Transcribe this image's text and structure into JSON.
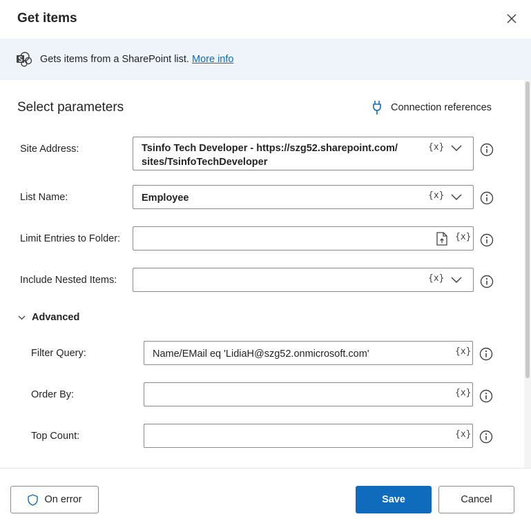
{
  "dialog": {
    "title": "Get items",
    "close_icon": "close-icon"
  },
  "info": {
    "text": "Gets items from a SharePoint list.",
    "link": "More info",
    "icon": "sharepoint-icon"
  },
  "params": {
    "section_title": "Select parameters",
    "connection_references": "Connection references",
    "var_token": "{x}",
    "site_address": {
      "label": "Site Address:",
      "line1": "Tsinfo Tech Developer - https://szg52.sharepoint.com/",
      "line2": "sites/TsinfoTechDeveloper"
    },
    "list_name": {
      "label": "List Name:",
      "value": "Employee"
    },
    "limit_folder": {
      "label": "Limit Entries to Folder:",
      "value": ""
    },
    "nested_items": {
      "label": "Include Nested Items:",
      "value": ""
    }
  },
  "advanced": {
    "label": "Advanced",
    "filter_query": {
      "label": "Filter Query:",
      "value": "Name/EMail eq 'LidiaH@szg52.onmicrosoft.com'"
    },
    "order_by": {
      "label": "Order By:",
      "value": ""
    },
    "top_count": {
      "label": "Top Count:",
      "value": ""
    }
  },
  "footer": {
    "on_error": "On error",
    "save": "Save",
    "cancel": "Cancel"
  },
  "colors": {
    "accent": "#0f6cbd",
    "info_bg": "#eff4fb",
    "text": "#242424",
    "border": "#8a8a8a"
  }
}
